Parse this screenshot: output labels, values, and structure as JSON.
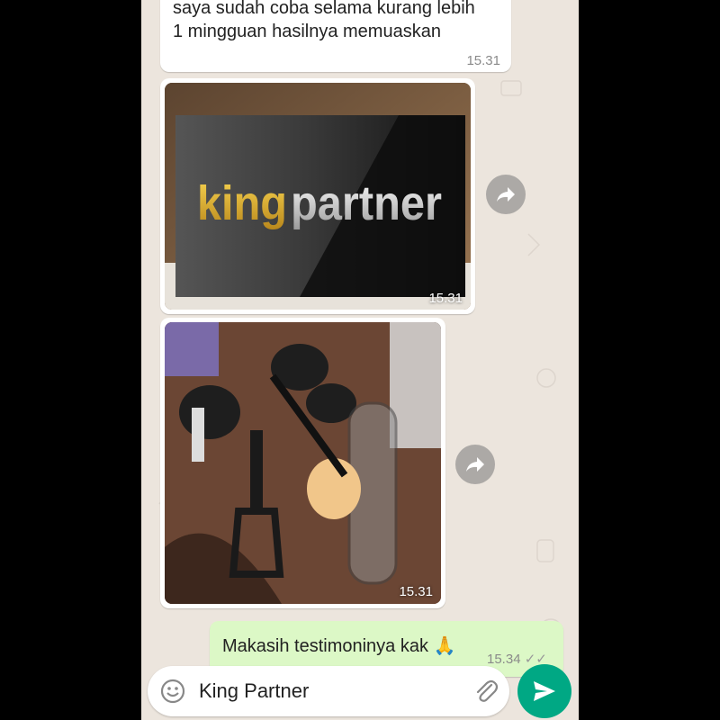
{
  "messages": [
    {
      "id": "msg-1",
      "lines": [
        "saya sudah coba selama kurang lebih",
        "1 mingguan hasilnya memuaskan"
      ],
      "time": "15.31"
    },
    {
      "id": "img-1",
      "logo": {
        "part1": "king",
        "part2": "partner"
      },
      "time": "15.31"
    },
    {
      "id": "img-2",
      "time": "15.31"
    },
    {
      "id": "msg-out",
      "text": "Makasih testimoninya kak",
      "emoji": "🙏",
      "time": "15.34",
      "ticks": "✓✓"
    }
  ],
  "composer": {
    "text": "King Partner",
    "emoji_icon": "emoji-icon",
    "attach_icon": "paperclip-icon",
    "send_icon": "send-icon"
  },
  "colors": {
    "chat_bg": "#ece5dd",
    "incoming": "#ffffff",
    "outgoing": "#dcf8c6",
    "send": "#00a884",
    "logo_gold": "#e3b52a"
  }
}
